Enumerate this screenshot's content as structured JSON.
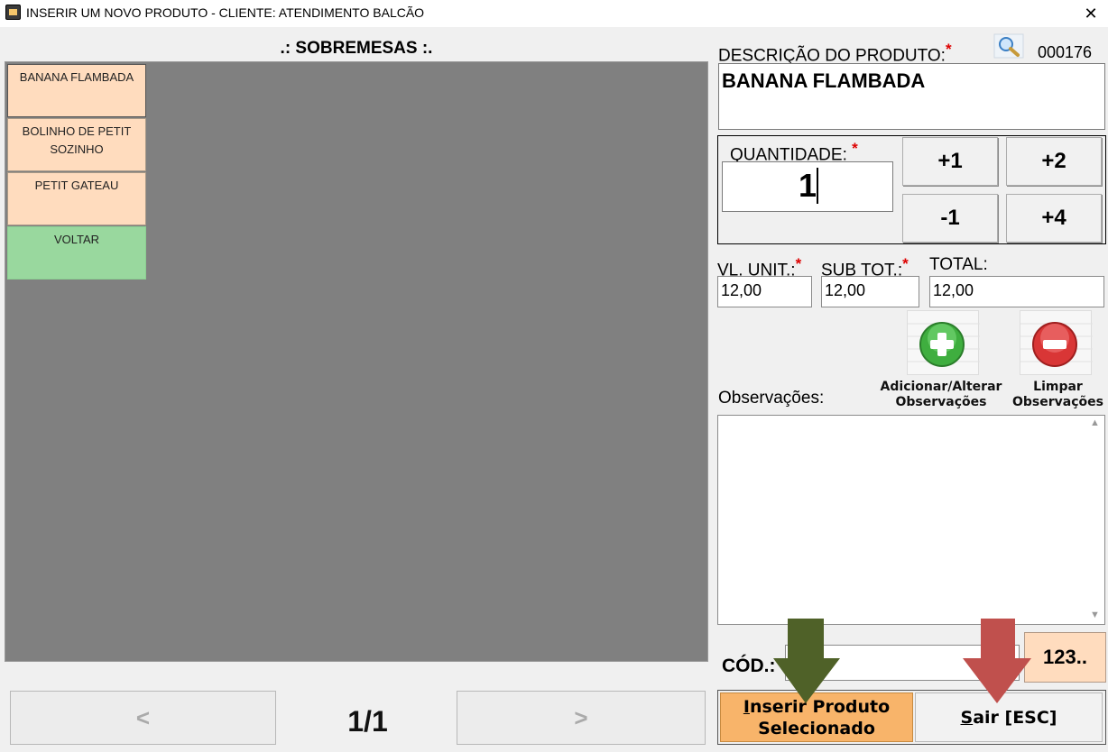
{
  "window": {
    "title": "INSERIR UM NOVO PRODUTO - CLIENTE: ATENDIMENTO BALCÃO",
    "close_symbol": "✕"
  },
  "category": {
    "title": ".: SOBREMESAS :.",
    "products": [
      {
        "label": "BANANA FLAMBADA",
        "color": "#ffdcbe",
        "selected": true
      },
      {
        "label": "BOLINHO DE PETIT SOZINHO",
        "color": "#ffdcbe"
      },
      {
        "label": "PETIT GATEAU",
        "color": "#ffdcbe"
      },
      {
        "label": "VOLTAR",
        "color": "#99d89e"
      }
    ]
  },
  "pagination": {
    "prev_label": "<",
    "next_label": ">",
    "page_text": "1/1"
  },
  "product": {
    "description_label": "DESCRIÇÃO DO PRODUTO:",
    "required_mark": "*",
    "code": "000176",
    "description": "BANANA FLAMBADA"
  },
  "quantity": {
    "label": "QUANTIDADE:",
    "value": "1",
    "buttons": {
      "plus1": "+1",
      "plus2": "+2",
      "minus1": "-1",
      "plus4": "+4"
    }
  },
  "prices": {
    "unit_label": "VL. UNIT.:",
    "sub_label": "SUB TOT.:",
    "total_label": "TOTAL:",
    "unit_value": "12,00",
    "sub_value": "12,00",
    "total_value": "12,00"
  },
  "observations": {
    "label": "Observações:",
    "add_line1": "Adicionar/Alterar",
    "add_line2": "Observações",
    "clear_line1": "Limpar",
    "clear_line2": "Observações",
    "value": "",
    "add_icon": "green-plus-icon",
    "clear_icon": "red-minus-icon"
  },
  "code_entry": {
    "label": "CÓD.:",
    "value": "",
    "numpad_label": "123.."
  },
  "actions": {
    "insert_hotkey": "I",
    "insert_rest_line1": "nserir Produto",
    "insert_line2": "Selecionado",
    "exit_hotkey": "S",
    "exit_rest": "air [ESC]"
  },
  "colors": {
    "accent_peach": "#ffdcbe",
    "insert_orange": "#f8b46a",
    "voltar_green": "#99d89e",
    "arrow_green": "#4f6128",
    "arrow_red": "#c0504d"
  }
}
